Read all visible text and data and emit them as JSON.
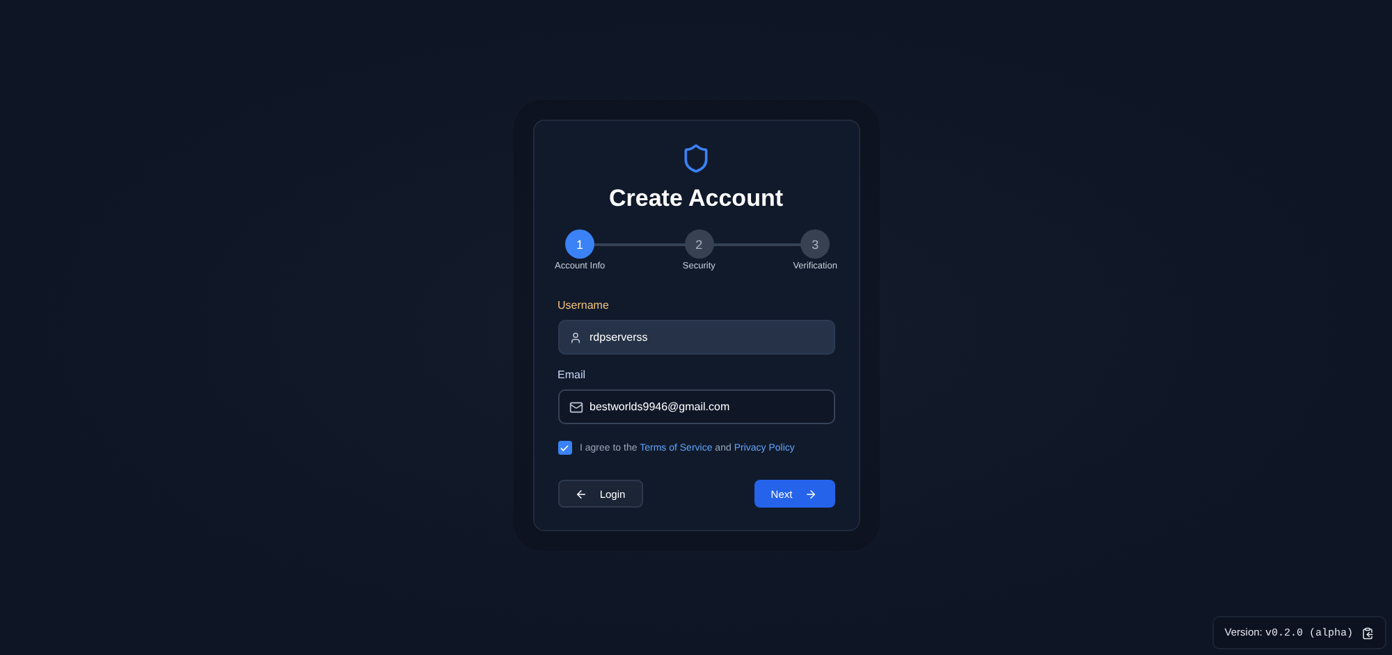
{
  "card": {
    "title": "Create Account"
  },
  "steps": [
    {
      "number": "1",
      "label": "Account Info",
      "selected": true
    },
    {
      "number": "2",
      "label": "Security",
      "selected": false
    },
    {
      "number": "3",
      "label": "Verification",
      "selected": false
    }
  ],
  "fields": [
    {
      "label": "Username",
      "value": "rdpserverss",
      "kind": "user",
      "focused": true
    },
    {
      "label": "Email",
      "value": "bestworlds9946@gmail.com",
      "kind": "mail",
      "focused": false
    }
  ],
  "agreement": {
    "checked": true,
    "parts": [
      {
        "kind": "text",
        "text": "I agree to the"
      },
      {
        "kind": "link",
        "text": "Terms of Service"
      },
      {
        "kind": "text",
        "text": "and"
      },
      {
        "kind": "link",
        "text": "Privacy Policy"
      }
    ]
  },
  "buttons": [
    {
      "label": "Login",
      "kind": "back"
    },
    {
      "label": "Next",
      "kind": "next"
    }
  ],
  "version": {
    "label": "Version:",
    "value": "v0.2.0 (alpha)"
  }
}
